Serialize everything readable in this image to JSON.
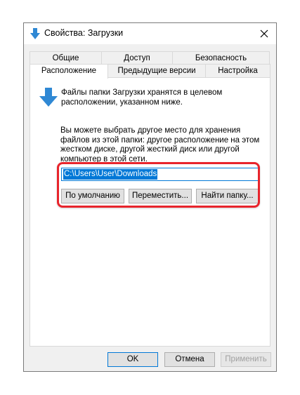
{
  "window": {
    "title": "Свойства: Загрузки",
    "close_glyph": "✕"
  },
  "tabs": {
    "back_row": [
      "Общие",
      "Доступ",
      "Безопасность"
    ],
    "front_row": [
      "Расположение",
      "Предыдущие версии",
      "Настройка"
    ],
    "active": "Расположение"
  },
  "location": {
    "description": "Файлы папки Загрузки хранятся в целевом расположении, указанном ниже.",
    "info": "Вы можете выбрать другое место для хранения файлов из этой папки: другое расположение на этом жестком диске, другой жесткий диск или другой компьютер в этой сети.",
    "path_value": "C:\\Users\\User\\Downloads",
    "default_button": "По умолчанию",
    "move_button": "Переместить...",
    "find_button": "Найти папку..."
  },
  "footer": {
    "ok_button": "OK",
    "cancel_button": "Отмена",
    "apply_button": "Применить"
  },
  "colors": {
    "accent": "#0078d7",
    "highlight": "#e8242c",
    "icon_blue": "#2f88d4"
  },
  "icons": {
    "title_icon": "download-arrow-icon",
    "folder_icon": "download-arrow-icon",
    "close_icon": "close-icon"
  }
}
